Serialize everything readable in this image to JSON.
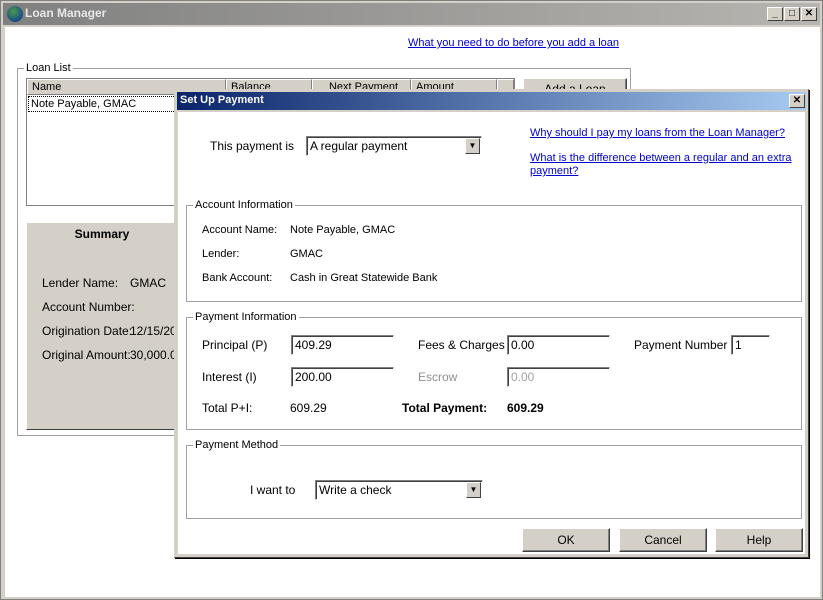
{
  "window": {
    "title": "Loan Manager"
  },
  "main": {
    "top_link": "What you need to do before you add a loan",
    "loan_list": {
      "group_label": "Loan List",
      "columns": [
        "Name",
        "Balance",
        "Next Payment",
        "Amount"
      ],
      "rows": [
        {
          "name": "Note Payable, GMAC"
        }
      ],
      "add_button": "Add a Loan"
    },
    "summary": {
      "tab_label": "Summary",
      "lender_label": "Lender Name:",
      "lender_value": "GMAC",
      "account_label": "Account Number:",
      "origination_label": "Origination Date:",
      "origination_value": "12/15/20",
      "original_label": "Original Amount:",
      "original_value": "30,000.0("
    }
  },
  "dialog": {
    "title": "Set Up Payment",
    "payment_is_label": "This payment is",
    "payment_type": "A regular payment",
    "link1": "Why should I pay my loans from the Loan Manager?",
    "link2a": "What is the difference between a regular and an extra",
    "link2b": "payment?",
    "account_info": {
      "group_label": "Account Information",
      "account_name_label": "Account Name:",
      "account_name_value": "Note Payable, GMAC",
      "lender_label": "Lender:",
      "lender_value": "GMAC",
      "bank_account_label": "Bank Account:",
      "bank_account_value": "Cash in Great Statewide Bank"
    },
    "payment_info": {
      "group_label": "Payment Information",
      "principal_label": "Principal (P)",
      "principal_value": "409.29",
      "fees_label": "Fees & Charges",
      "fees_value": "0.00",
      "payment_number_label": "Payment Number",
      "payment_number_value": "1",
      "interest_label": "Interest (I)",
      "interest_value": "200.00",
      "escrow_label": "Escrow",
      "escrow_value": "0.00",
      "total_pi_label": "Total P+I:",
      "total_pi_value": "609.29",
      "total_payment_label": "Total Payment:",
      "total_payment_value": "609.29"
    },
    "payment_method": {
      "group_label": "Payment Method",
      "i_want_to_label": "I want to",
      "method_value": "Write a check"
    },
    "buttons": {
      "ok": "OK",
      "cancel": "Cancel",
      "help": "Help"
    }
  }
}
